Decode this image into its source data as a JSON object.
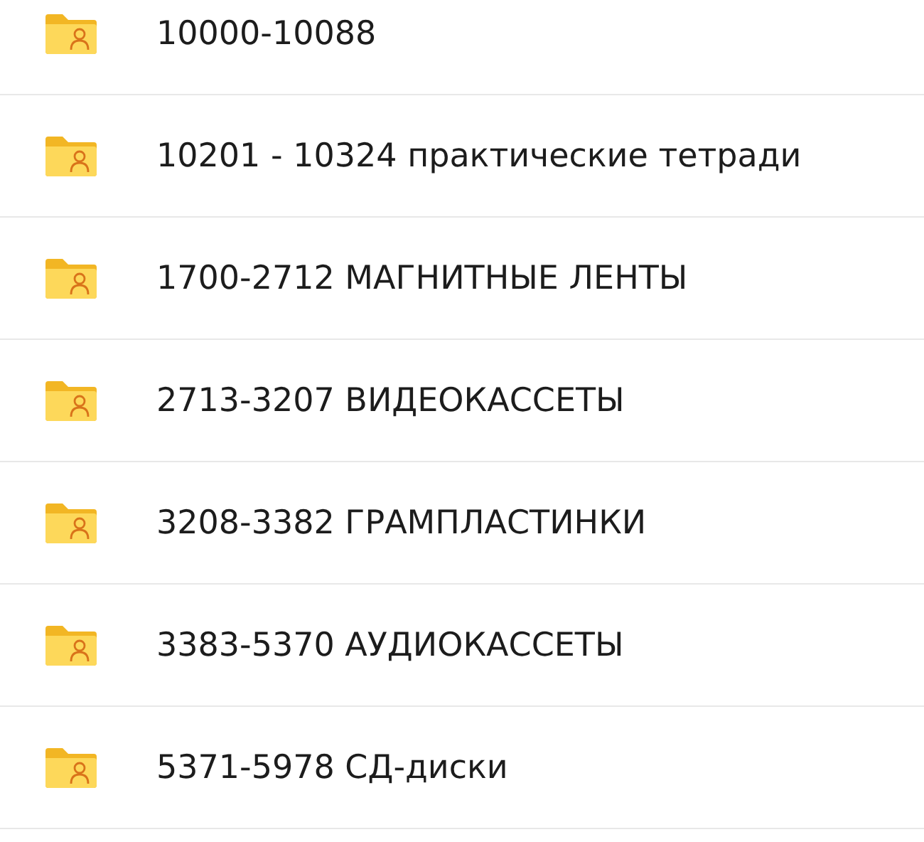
{
  "folders": [
    {
      "name": "10000-10088"
    },
    {
      "name": "10201 - 10324 практические тетради"
    },
    {
      "name": "1700-2712 МАГНИТНЫЕ ЛЕНТЫ"
    },
    {
      "name": "2713-3207 ВИДЕОКАССЕТЫ"
    },
    {
      "name": "3208-3382 ГРАМПЛАСТИНКИ"
    },
    {
      "name": "3383-5370 АУДИОКАССЕТЫ"
    },
    {
      "name": "5371-5978 СД-диски"
    }
  ]
}
